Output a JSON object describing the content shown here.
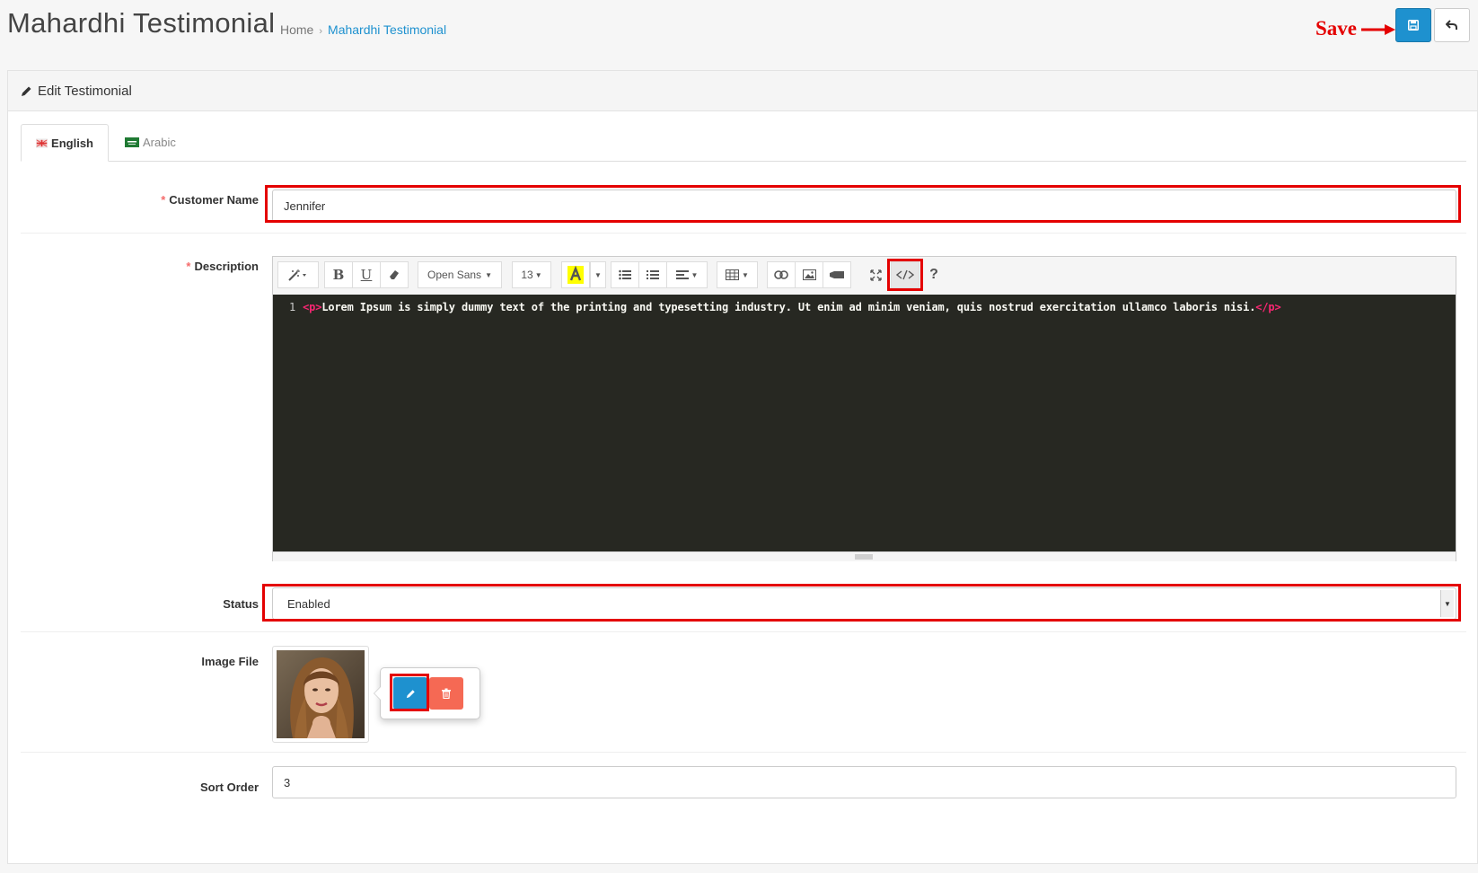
{
  "header": {
    "title": "Mahardhi Testimonial",
    "breadcrumb": [
      {
        "label": "Home"
      },
      {
        "label": "Mahardhi Testimonial"
      }
    ],
    "save_annotation": "Save",
    "accent_color": "#1e91cf",
    "save_button_icon": "save-icon",
    "back_button_icon": "back-icon"
  },
  "panel": {
    "heading": "Edit Testimonial",
    "heading_icon": "pencil-icon",
    "tabs": [
      {
        "label": "English",
        "active": true
      },
      {
        "label": "Arabic",
        "active": false
      }
    ]
  },
  "form": {
    "customer_name": {
      "label": "Customer Name",
      "required": true,
      "value": "Jennifer"
    },
    "description": {
      "label": "Description",
      "required": true,
      "toolbar": {
        "font_family": "Open Sans",
        "font_size": "13",
        "help": "?"
      },
      "code_line_number": "1",
      "code_open_tag": "<p>",
      "code_text": "Lorem Ipsum is simply dummy text of the printing and typesetting industry. Ut enim ad minim veniam, quis nostrud exercitation ullamco laboris nisi.",
      "code_close_tag": "</p>"
    },
    "status": {
      "label": "Status",
      "value": "Enabled"
    },
    "image": {
      "label": "Image File",
      "edit_icon": "pencil-icon",
      "delete_icon": "trash-icon"
    },
    "sort_order": {
      "label": "Sort Order",
      "value": "3"
    }
  },
  "colors": {
    "annotation_red": "#e40000",
    "danger": "#f56954",
    "primary": "#1e91cf",
    "editor_bg": "#272822",
    "tag_color": "#f92672"
  }
}
